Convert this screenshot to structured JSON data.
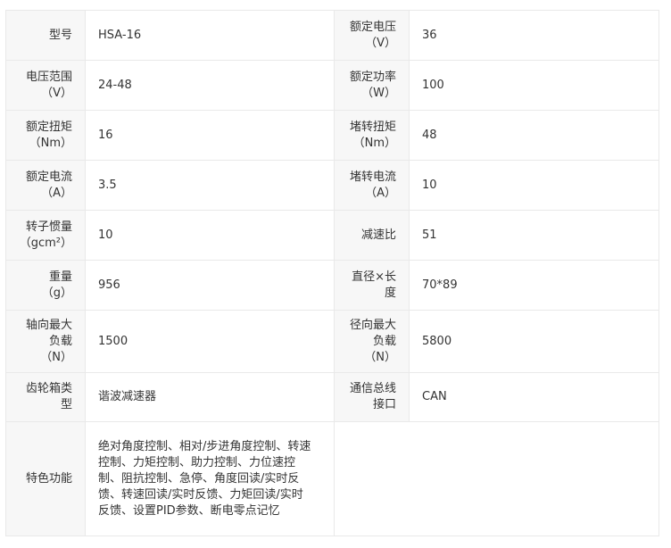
{
  "rows": [
    [
      {
        "label": [
          "型号"
        ],
        "value": "HSA-16"
      },
      {
        "label": [
          "额定电压",
          "（V）"
        ],
        "value": "36"
      }
    ],
    [
      {
        "label": [
          "电压范围",
          "（V）"
        ],
        "value": "24-48"
      },
      {
        "label": [
          "额定功率",
          "（W）"
        ],
        "value": "100"
      }
    ],
    [
      {
        "label": [
          "额定扭矩",
          "（Nm）"
        ],
        "value": "16"
      },
      {
        "label": [
          "堵转扭矩",
          "（Nm）"
        ],
        "value": "48"
      }
    ],
    [
      {
        "label": [
          "额定电流",
          "（A）"
        ],
        "value": "3.5"
      },
      {
        "label": [
          "堵转电流",
          "（A）"
        ],
        "value": "10"
      }
    ],
    [
      {
        "label": [
          "转子惯量",
          "（gcm²）"
        ],
        "value": "10"
      },
      {
        "label": [
          "减速比"
        ],
        "value": "51"
      }
    ],
    [
      {
        "label": [
          "重量",
          "（g）"
        ],
        "value": "956"
      },
      {
        "label": [
          "直径×长",
          "度"
        ],
        "value": "70*89"
      }
    ],
    [
      {
        "label": [
          "轴向最大",
          "负载",
          "（N）"
        ],
        "value": "1500"
      },
      {
        "label": [
          "径向最大",
          "负载",
          "（N）"
        ],
        "value": "5800"
      }
    ],
    [
      {
        "label": [
          "齿轮箱类",
          "型"
        ],
        "value": "谐波减速器"
      },
      {
        "label": [
          "通信总线",
          "接口"
        ],
        "value": "CAN"
      }
    ]
  ],
  "features": {
    "label": "特色功能",
    "lines": [
      "绝对角度控制、相对/步进角度控制、转速",
      "控制、力矩控制、助力控制、力位速控",
      "制、阻抗控制、急停、角度回读/实时反",
      "馈、转速回读/实时反馈、力矩回读/实时",
      "反馈、设置PID参数、断电零点记忆"
    ]
  }
}
